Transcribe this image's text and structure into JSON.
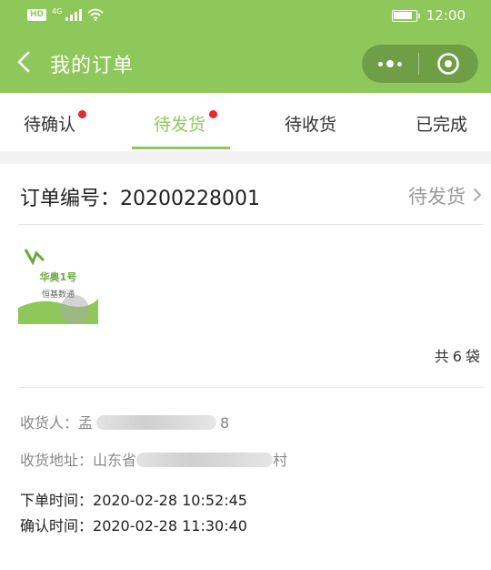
{
  "status_bar": {
    "hd": "HD",
    "network": "4G",
    "time": "12:00",
    "battery_level": 0.85
  },
  "nav": {
    "title": "我的订单"
  },
  "tabs": [
    {
      "label": "待确认",
      "has_dot": true,
      "active": false
    },
    {
      "label": "待发货",
      "has_dot": true,
      "active": true
    },
    {
      "label": "待收货",
      "has_dot": false,
      "active": false
    },
    {
      "label": "已完成",
      "has_dot": false,
      "active": false
    }
  ],
  "order": {
    "number_label": "订单编号：",
    "number": "20200228001",
    "status": "待发货",
    "product_image": {
      "brand": "恒基数通",
      "name": "华奥1号"
    },
    "quantity_prefix": "共",
    "quantity": "6",
    "quantity_unit": "袋",
    "receiver_label": "收货人：",
    "receiver_name_start": "孟",
    "receiver_name_end": "8",
    "address_label": "收货地址：",
    "address_start": "山东省",
    "address_end": "村",
    "order_time_label": "下单时间：",
    "order_time": "2020-02-28 10:52:45",
    "confirm_time_label": "确认时间：",
    "confirm_time": "2020-02-28 11:30:40"
  },
  "colors": {
    "brand_green": "#8fc85a",
    "red_dot": "#e8282a",
    "muted_text": "#999999"
  }
}
